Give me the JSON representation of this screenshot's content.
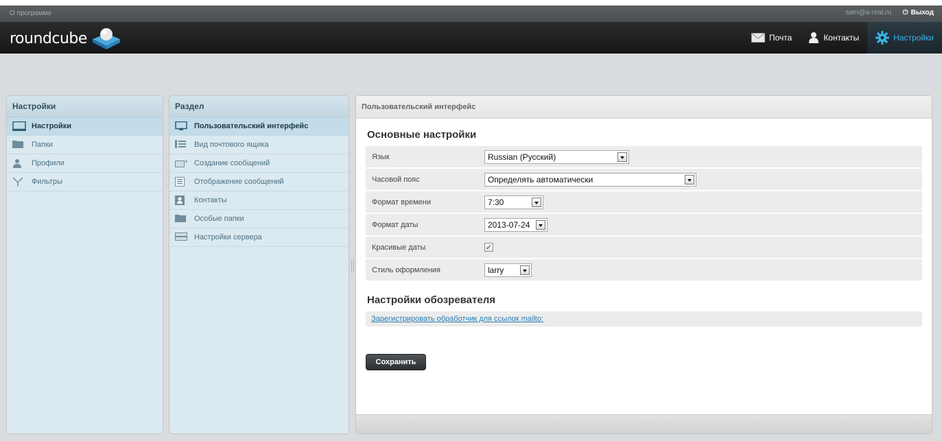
{
  "topline": {
    "about": "О программе",
    "user": "sam@a-real.ru",
    "logout": "Выход"
  },
  "header": {
    "logo": "roundcube",
    "nav": [
      {
        "label": "Почта",
        "icon": "mail-icon"
      },
      {
        "label": "Контакты",
        "icon": "contacts-icon"
      },
      {
        "label": "Настройки",
        "icon": "gear-icon",
        "active": true
      }
    ]
  },
  "settings_panel": {
    "title": "Настройки",
    "items": [
      {
        "label": "Настройки",
        "icon": "monitor-icon",
        "selected": true
      },
      {
        "label": "Папки",
        "icon": "folder-icon"
      },
      {
        "label": "Профили",
        "icon": "identity-icon"
      },
      {
        "label": "Фильтры",
        "icon": "filter-icon"
      }
    ]
  },
  "section_panel": {
    "title": "Раздел",
    "items": [
      {
        "label": "Пользовательский интерфейс",
        "icon": "monitor-icon",
        "selected": true
      },
      {
        "label": "Вид почтового ящика",
        "icon": "list-icon"
      },
      {
        "label": "Создание сообщений",
        "icon": "compose-icon"
      },
      {
        "label": "Отображение сообщений",
        "icon": "message-view-icon"
      },
      {
        "label": "Контакты",
        "icon": "addressbook-icon"
      },
      {
        "label": "Особые папки",
        "icon": "folder-icon"
      },
      {
        "label": "Настройки сервера",
        "icon": "server-icon"
      }
    ]
  },
  "content": {
    "title": "Пользовательский интерфейс",
    "main_section": "Основные настройки",
    "rows": {
      "language": {
        "label": "Язык",
        "value": "Russian (Русский)"
      },
      "timezone": {
        "label": "Часовой пояс",
        "value": "Определять автоматически"
      },
      "time_format": {
        "label": "Формат времени",
        "value": "7:30"
      },
      "date_format": {
        "label": "Формат даты",
        "value": "2013-07-24"
      },
      "pretty_dates": {
        "label": "Красивые даты",
        "checked": true
      },
      "skin": {
        "label": "Стиль оформления",
        "value": "larry"
      }
    },
    "browser_section": "Настройки обозревателя",
    "mailto_link": "Зарегистрировать обработчик для ссылок mailto:",
    "save": "Сохранить"
  },
  "colors": {
    "accent": "#3ab3e6",
    "panel_blue": "#dbe9f0",
    "header_dark": "#1e2022"
  }
}
